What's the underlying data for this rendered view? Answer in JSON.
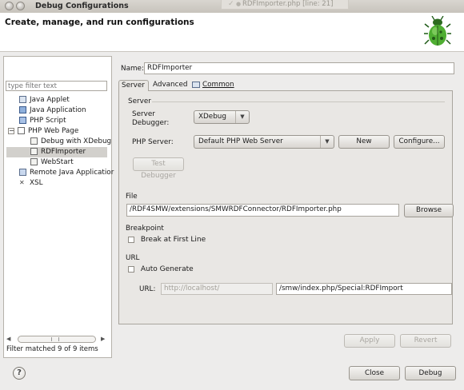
{
  "window": {
    "title": "Debug Configurations",
    "background_tab": "RDFImporter.php [line: 21]"
  },
  "header": {
    "title": "Create, manage, and run configurations",
    "logo_icon": "bug-icon"
  },
  "toolbar": {
    "icons": [
      "new-config-icon",
      "duplicate-icon",
      "delete-icon",
      "collapse-all-icon",
      "filter-icon"
    ]
  },
  "filter": {
    "placeholder": "type filter text"
  },
  "tree": {
    "items": [
      {
        "label": "Java Applet",
        "icon": "java-applet-icon"
      },
      {
        "label": "Java Application",
        "icon": "java-app-icon"
      },
      {
        "label": "PHP Script",
        "icon": "php-script-icon"
      },
      {
        "label": "PHP Web Page",
        "icon": "php-web-page-icon",
        "expanded": true
      },
      {
        "label": "Debug with XDebug",
        "icon": "page-icon"
      },
      {
        "label": "RDFImporter",
        "icon": "page-icon",
        "selected": true
      },
      {
        "label": "WebStart",
        "icon": "page-icon"
      },
      {
        "label": "Remote Java Applicatior",
        "icon": "remote-java-icon"
      },
      {
        "label": "XSL",
        "icon": "xsl-icon"
      }
    ],
    "status": "Filter matched 9 of 9 items"
  },
  "config": {
    "name_label": "Name:",
    "name_value": "RDFImporter",
    "tabs": [
      {
        "label": "Server",
        "active": true
      },
      {
        "label": "Advanced",
        "active": false
      },
      {
        "label": "Common",
        "active": false
      }
    ],
    "server_group": "Server",
    "server_debugger_label": "Server Debugger:",
    "server_debugger_value": "XDebug",
    "php_server_label": "PHP Server:",
    "php_server_value": "Default PHP Web Server",
    "new_button": "New",
    "configure_button": "Configure...",
    "test_debugger_button": "Test Debugger",
    "file_group": "File",
    "file_value": "/RDF4SMW/extensions/SMWRDFConnector/RDFImporter.php",
    "browse_button": "Browse",
    "breakpoint_group": "Breakpoint",
    "break_first_line": "Break at First Line",
    "url_group": "URL",
    "auto_generate": "Auto Generate",
    "url_label": "URL:",
    "url_base": "http://localhost/",
    "url_path": "/smw/index.php/Special:RDFImport",
    "apply_button": "Apply",
    "revert_button": "Revert"
  },
  "footer": {
    "help_icon": "help-icon",
    "close_button": "Close",
    "debug_button": "Debug"
  },
  "colors": {
    "accent_green": "#3a8f2a",
    "delete_red": "#c8241c",
    "panel_bg": "#edeceb",
    "selection": "#d2d0cc"
  }
}
